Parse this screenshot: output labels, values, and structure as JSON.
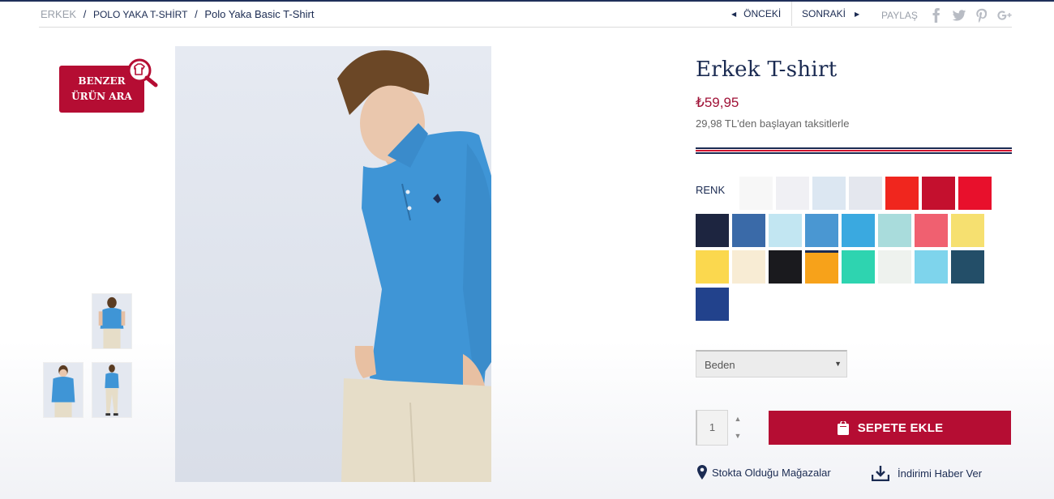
{
  "breadcrumb": {
    "items": [
      "ERKEK",
      "POLO YAKA T-SHİRT",
      "Polo Yaka Basic T-Shirt"
    ],
    "separator": "/"
  },
  "nav": {
    "prev_label": "ÖNCEKİ",
    "next_label": "SONRAKİ",
    "share_label": "PAYLAŞ",
    "share_icons": [
      "facebook-icon",
      "twitter-icon",
      "pinterest-icon",
      "google-plus-icon"
    ]
  },
  "similar": {
    "line1": "BENZER",
    "line2": "ÜRÜN ARA"
  },
  "product": {
    "title": "Erkek T-shirt",
    "price": "₺59,95",
    "installment": "29,98 TL'den başlayan taksitlerle"
  },
  "colors": {
    "label": "RENK",
    "swatches": [
      "#f7f7f7",
      "#f0f0f4",
      "#dce7f2",
      "#e4e7ee",
      "#f0261e",
      "#c4102e",
      "#e8102c",
      "#1d2540",
      "#3a6aa8",
      "#c2e6f2",
      "#4a97d2",
      "#3aa9e0",
      "#a9dcdc",
      "#f06070",
      "#f6e070",
      "#fbd84e",
      "#f8ecd4",
      "#1a1a1e",
      "#f7a21a",
      "#2ed4b0",
      "#eef2ee",
      "#7ed4ec",
      "#234e68",
      "#22428c"
    ],
    "selected_index": 18
  },
  "size_select": {
    "value": "Beden"
  },
  "cart": {
    "quantity": "1",
    "button_label": "SEPETE EKLE"
  },
  "links": {
    "stores": "Stokta Olduğu Mağazalar",
    "alert": "İndirimi Haber Ver"
  },
  "theme": {
    "brand_red": "#b50d33",
    "navy": "#1b2b52"
  }
}
